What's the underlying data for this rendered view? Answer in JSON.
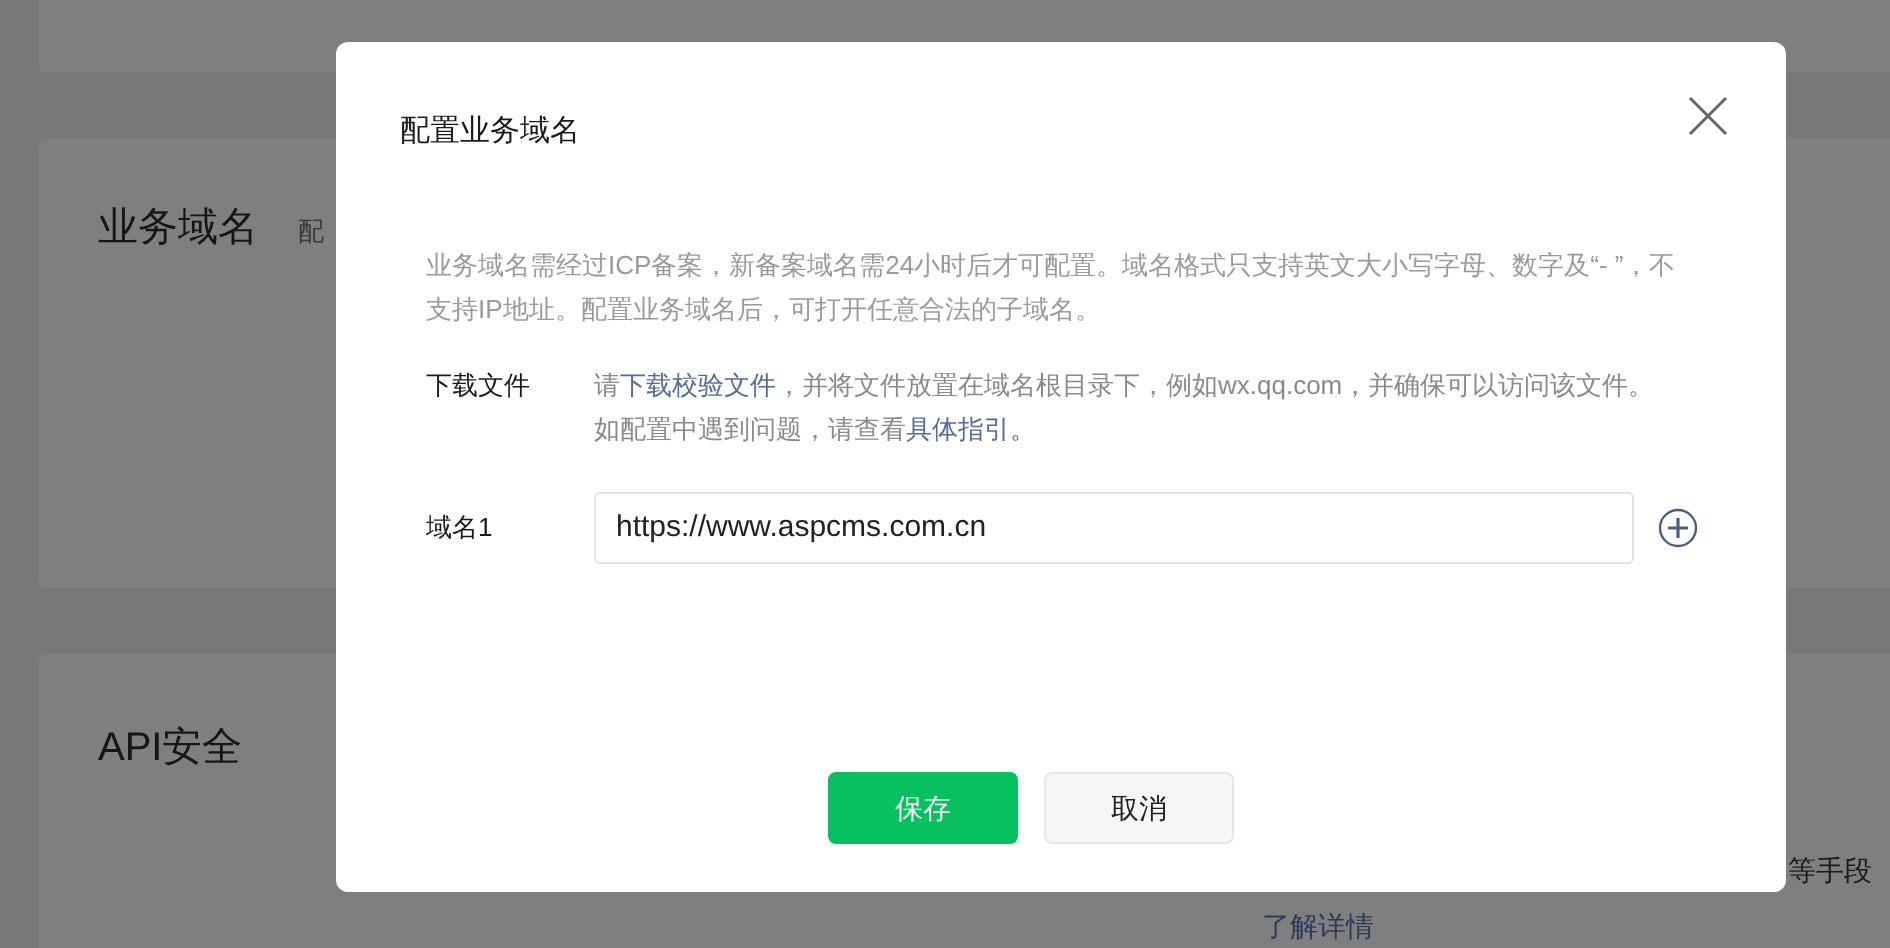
{
  "background": {
    "sections": [
      {
        "title": "业务域名",
        "note": "配"
      },
      {
        "title": "API安全"
      }
    ],
    "partial_text": "等手段",
    "link": "了解详情"
  },
  "dialog": {
    "title": "配置业务域名",
    "description": "业务域名需经过ICP备案，新备案域名需24小时后才可配置。域名格式只支持英文大小写字母、数字及“- ”，不支持IP地址。配置业务域名后，可打开任意合法的子域名。",
    "download": {
      "label": "下载文件",
      "prefix": "请",
      "link": "下载校验文件",
      "middle": "，并将文件放置在域名根目录下，例如wx.qq.com，并确保可以访问该文件。如配置中遇到问题，请查看",
      "guide_link": "具体指引。"
    },
    "domains": [
      {
        "label": "域名1",
        "value": "https://www.aspcms.com.cn"
      }
    ],
    "buttons": [
      {
        "label": "保存",
        "kind": "primary"
      },
      {
        "label": "取消",
        "kind": "secondary"
      }
    ]
  }
}
